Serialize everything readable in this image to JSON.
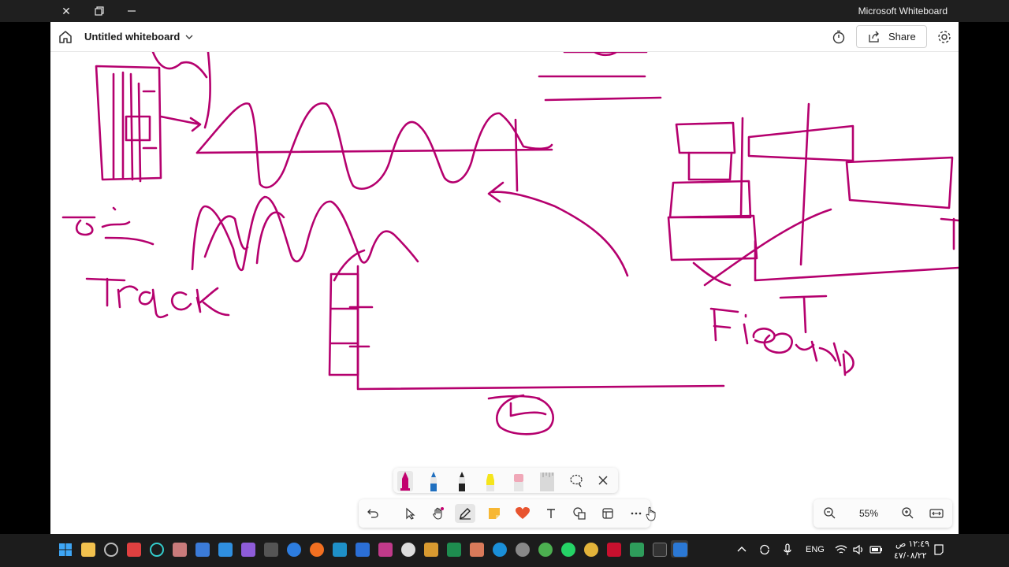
{
  "window": {
    "app_name": "Microsoft Whiteboard",
    "controls": [
      "close-icon",
      "restore-icon",
      "minimize-icon"
    ]
  },
  "header": {
    "title": "Untitled whiteboard",
    "share_label": "Share"
  },
  "canvas": {
    "ink_color": "#b5006e",
    "background": "#ffffff"
  },
  "pen_tray": {
    "pens": [
      {
        "name": "magenta-pen",
        "color": "#c2006e"
      },
      {
        "name": "blue-pen",
        "color": "#1f6fbf"
      },
      {
        "name": "black-pen",
        "color": "#222222"
      },
      {
        "name": "yellow-highlighter",
        "color": "#f5e51c"
      },
      {
        "name": "pink-eraser",
        "color": "#f0a8b8"
      },
      {
        "name": "ruler",
        "color": "#d9d9d9"
      }
    ]
  },
  "toolbar": {
    "tools": [
      "undo-icon",
      "select-icon",
      "pan-icon",
      "pen-icon",
      "sticky-note-icon",
      "reaction-icon",
      "text-icon",
      "shapes-icon",
      "templates-icon",
      "more-icon"
    ]
  },
  "zoom": {
    "value": "55%"
  },
  "taskbar": {
    "language": "ENG",
    "time": "١٢:٤٩ ص",
    "date": "٤٧/٠٨/٢٢"
  }
}
